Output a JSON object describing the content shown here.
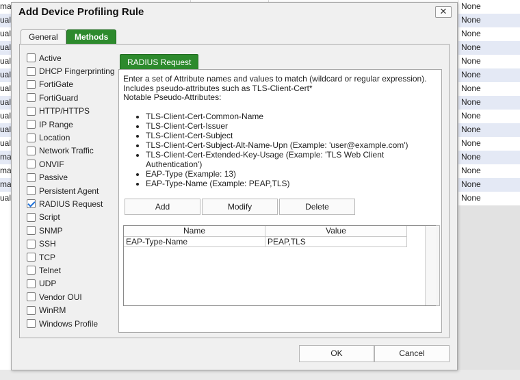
{
  "background_table": {
    "left_column_texts": [
      "mat",
      "ual",
      "ual",
      "ual",
      "ual",
      "ual",
      "ual",
      "ual",
      "ual",
      "ual",
      "ual",
      "mat",
      "mat",
      "mat",
      "ual"
    ],
    "right_column_texts": [
      "None",
      "None",
      "None",
      "None",
      "None",
      "None",
      "None",
      "None",
      "None",
      "None",
      "None",
      "None",
      "None",
      "None",
      "None"
    ]
  },
  "dialog": {
    "title": "Add Device Profiling Rule",
    "close_label": "✕",
    "tabs": {
      "general": "General",
      "methods": "Methods"
    },
    "methods": [
      {
        "label": "Active",
        "checked": false
      },
      {
        "label": "DHCP Fingerprinting",
        "checked": false
      },
      {
        "label": "FortiGate",
        "checked": false
      },
      {
        "label": "FortiGuard",
        "checked": false
      },
      {
        "label": "HTTP/HTTPS",
        "checked": false
      },
      {
        "label": "IP Range",
        "checked": false
      },
      {
        "label": "Location",
        "checked": false
      },
      {
        "label": "Network Traffic",
        "checked": false
      },
      {
        "label": "ONVIF",
        "checked": false
      },
      {
        "label": "Passive",
        "checked": false
      },
      {
        "label": "Persistent Agent",
        "checked": false
      },
      {
        "label": "RADIUS Request",
        "checked": true
      },
      {
        "label": "Script",
        "checked": false
      },
      {
        "label": "SNMP",
        "checked": false
      },
      {
        "label": "SSH",
        "checked": false
      },
      {
        "label": "TCP",
        "checked": false
      },
      {
        "label": "Telnet",
        "checked": false
      },
      {
        "label": "UDP",
        "checked": false
      },
      {
        "label": "Vendor OUI",
        "checked": false
      },
      {
        "label": "WinRM",
        "checked": false
      },
      {
        "label": "Windows Profile",
        "checked": false
      }
    ],
    "radius": {
      "tab_label": "RADIUS Request",
      "description": [
        "Enter a set of Attribute names and values to match (wildcard or regular expression).",
        "Includes pseudo-attributes such as TLS-Client-Cert*",
        "Notable Pseudo-Attributes:"
      ],
      "pseudo_attributes": [
        "TLS-Client-Cert-Common-Name",
        "TLS-Client-Cert-Issuer",
        "TLS-Client-Cert-Subject",
        "TLS-Client-Cert-Subject-Alt-Name-Upn (Example: 'user@example.com')",
        "TLS-Client-Cert-Extended-Key-Usage (Example: 'TLS Web Client Authentication')",
        "EAP-Type (Example: 13)",
        "EAP-Type-Name (Example: PEAP,TLS)"
      ],
      "buttons": {
        "add": "Add",
        "modify": "Modify",
        "delete": "Delete"
      },
      "table": {
        "headers": {
          "name": "Name",
          "value": "Value"
        },
        "rows": [
          {
            "name": "EAP-Type-Name",
            "value": "PEAP,TLS"
          }
        ]
      }
    },
    "footer": {
      "ok": "OK",
      "cancel": "Cancel"
    }
  }
}
